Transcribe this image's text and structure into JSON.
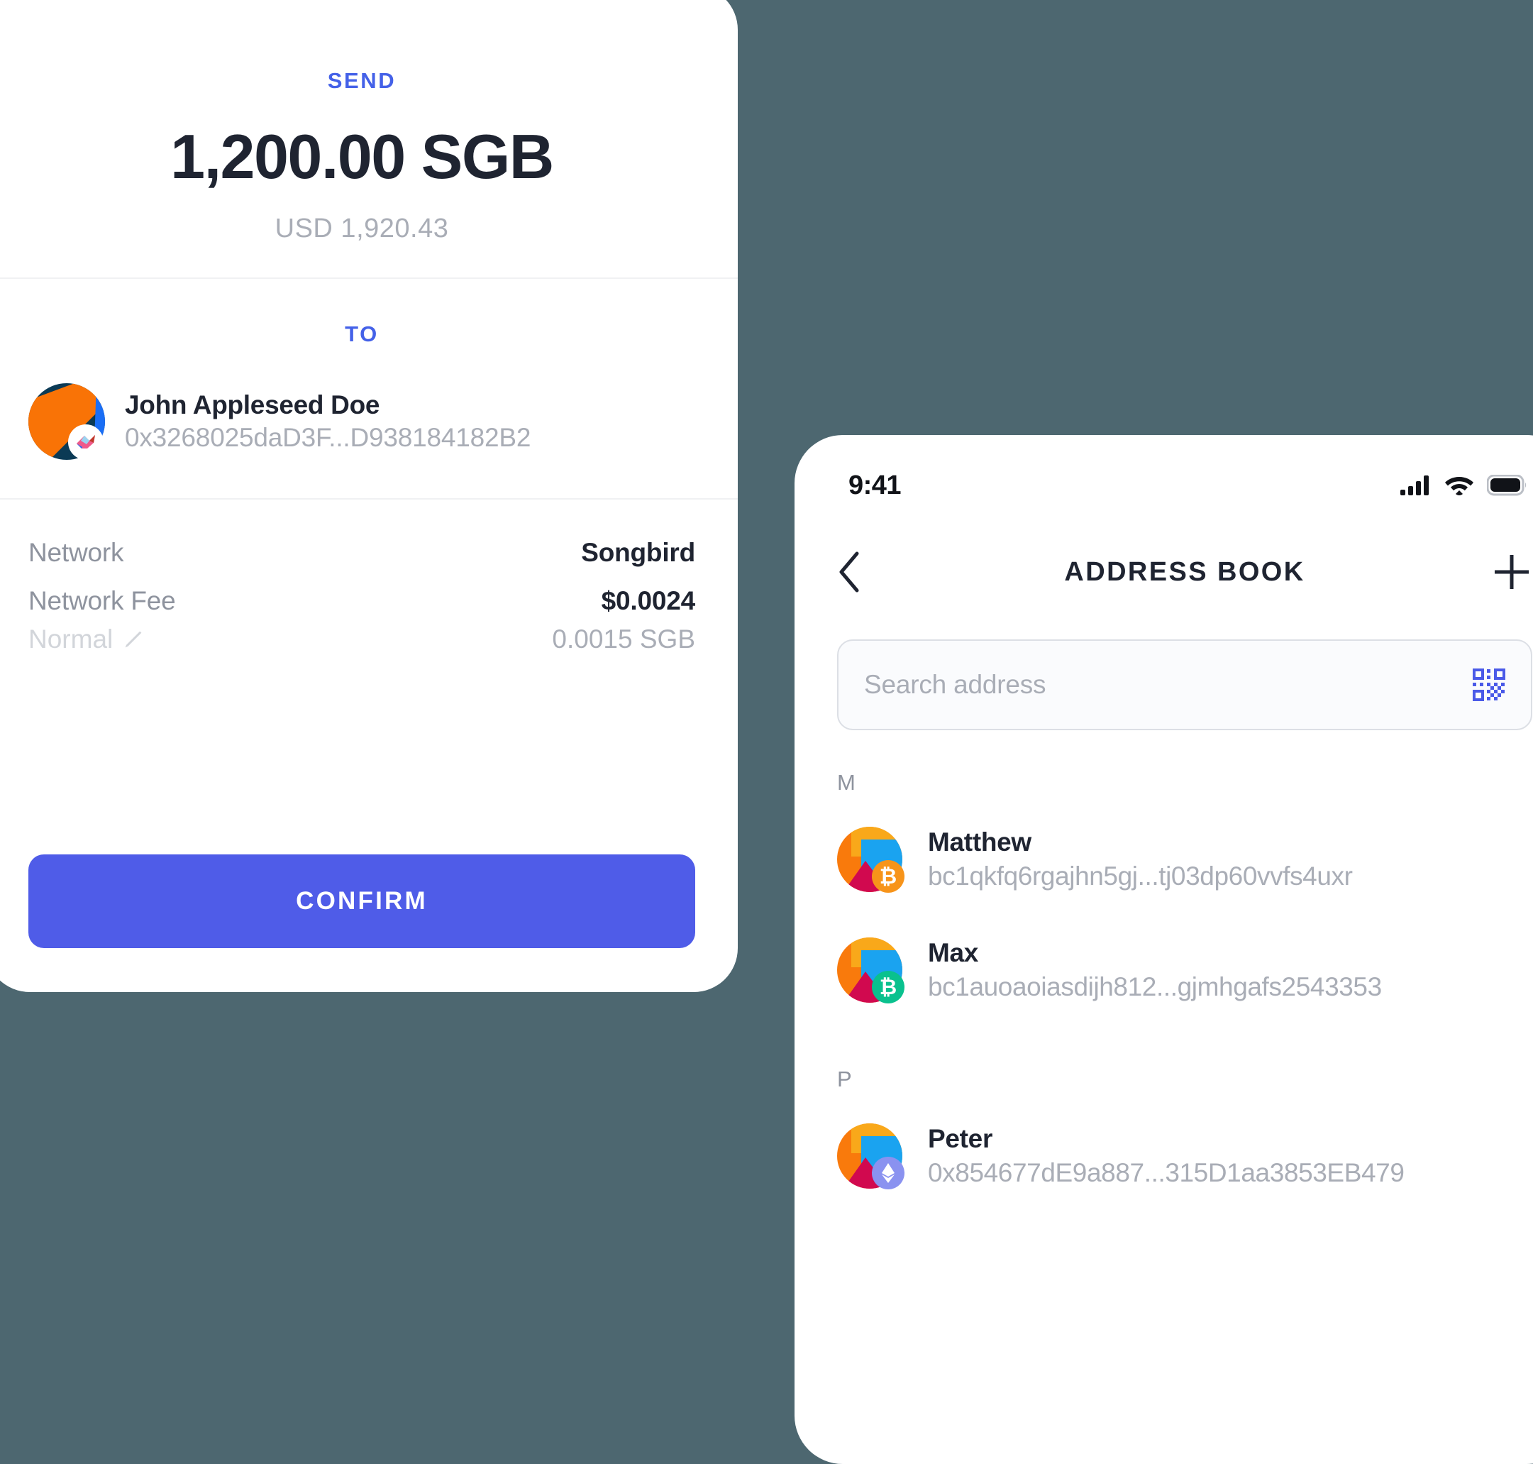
{
  "theme": {
    "background": "#4d6770",
    "accent_blue": "#4461e8",
    "button_blue": "#4f5ce8",
    "text_dark": "#1f2431",
    "text_muted": "#a9adb6"
  },
  "send_card": {
    "eyebrow": "SEND",
    "amount": "1,200.00 SGB",
    "fiat_amount": "USD 1,920.43",
    "to_label": "TO",
    "recipient": {
      "name": "John Appleseed Doe",
      "address": "0x3268025daD3F...D938184182B2",
      "avatar_icon": "songbird-identicon-avatar"
    },
    "details": [
      {
        "label": "Network",
        "value": "Songbird"
      },
      {
        "label": "Network Fee",
        "value": "$0.0024"
      }
    ],
    "fee_speed": {
      "label": "Normal",
      "edit_icon": "pencil-icon",
      "value": "0.0015 SGB"
    },
    "confirm_label": "CONFIRM"
  },
  "phone": {
    "status_bar": {
      "time": "9:41",
      "icons": [
        "cellular-signal-icon",
        "wifi-icon",
        "battery-icon"
      ]
    },
    "nav": {
      "back_icon": "chevron-left-icon",
      "title": "ADDRESS BOOK",
      "add_icon": "plus-icon"
    },
    "search": {
      "value": "",
      "placeholder": "Search address",
      "qr_icon": "qr-code-icon"
    },
    "groups": [
      {
        "letter": "M",
        "contacts": [
          {
            "name": "Matthew",
            "address": "bc1qkfq6rgajhn5gj...tj03dp60vvfs4uxr",
            "badge_icon": "bitcoin-badge-icon",
            "badge_color": "#f7941a",
            "badge_symbol": "₿"
          },
          {
            "name": "Max",
            "address": "bc1auoaoiasdijh812...gjmhgafs2543353",
            "badge_icon": "bitcoin-cash-badge-icon",
            "badge_color": "#0ac18e",
            "badge_symbol": "₿"
          }
        ]
      },
      {
        "letter": "P",
        "contacts": [
          {
            "name": "Peter",
            "address": "0x854677dE9a887...315D1aa3853EB479",
            "badge_icon": "ethereum-badge-icon",
            "badge_color": "#8a92f0",
            "badge_symbol": "◆"
          }
        ]
      }
    ]
  }
}
